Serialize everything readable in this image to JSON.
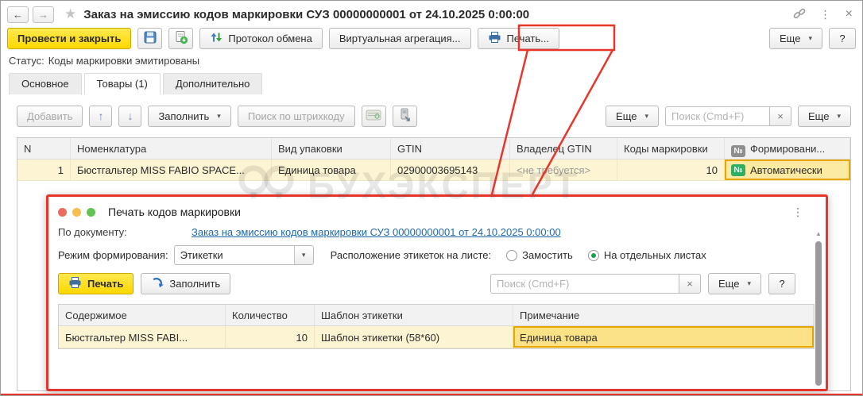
{
  "window": {
    "title": "Заказ на эмиссию кодов маркировки СУЗ 00000000001 от 24.10.2025 0:00:00"
  },
  "icons": {
    "back": "←",
    "forward": "→",
    "star": "★",
    "menu_dots": "⋮",
    "close": "×",
    "caret": "▾",
    "move_up": "↑",
    "move_down": "↓",
    "number_badge": "№",
    "scroll_up": "▲",
    "clear": "×"
  },
  "toolbar": {
    "post_and_close": "Провести и закрыть",
    "exchange_protocol": "Протокол обмена",
    "virtual_aggregation": "Виртуальная агрегация...",
    "print": "Печать...",
    "more": "Еще",
    "help": "?"
  },
  "status": {
    "label": "Статус:",
    "value": "Коды маркировки эмитированы"
  },
  "tabs": [
    {
      "label": "Основное"
    },
    {
      "label": "Товары (1)"
    },
    {
      "label": "Дополнительно"
    }
  ],
  "items_toolbar": {
    "add": "Добавить",
    "fill": "Заполнить",
    "barcode_search": "Поиск по штрихкоду",
    "more": "Еще",
    "search_placeholder": "Поиск (Cmd+F)",
    "more2": "Еще"
  },
  "items_table": {
    "headers": [
      "N",
      "Номенклатура",
      "Вид упаковки",
      "GTIN",
      "Владелец GTIN",
      "Коды маркировки",
      "Формировани..."
    ],
    "row": {
      "n": "1",
      "nomenclature": "Бюстгальтер MISS FABIO SPACE...",
      "packaging": "Единица товара",
      "gtin": "02900003695143",
      "gtin_owner": "<не требуется>",
      "marking_codes": "10",
      "formation": "Автоматически"
    }
  },
  "dialog": {
    "title": "Печать кодов маркировки",
    "by_document_label": "По документу:",
    "document_link": "Заказ на эмиссию кодов маркировки СУЗ 00000000001 от 24.10.2025 0:00:00",
    "mode_label": "Режим формирования:",
    "mode_value": "Этикетки",
    "layout_label": "Расположение этикеток на листе:",
    "layout_options": [
      {
        "label": "Замостить",
        "selected": false
      },
      {
        "label": "На отдельных листах",
        "selected": true
      }
    ],
    "print": "Печать",
    "fill": "Заполнить",
    "search_placeholder": "Поиск (Cmd+F)",
    "more": "Еще",
    "help": "?",
    "table": {
      "headers": [
        "Содержимое",
        "Количество",
        "Шаблон этикетки",
        "Примечание"
      ],
      "row": {
        "content": "Бюстгальтер MISS FABI...",
        "quantity": "10",
        "template": "Шаблон этикетки (58*60)",
        "note": "Единица товара"
      }
    }
  },
  "watermark": {
    "text": "БУХЭКСПЕРТ"
  },
  "colors": {
    "accent_yellow": "#ffdd00",
    "annotation_red": "#e8352c",
    "link_blue": "#2069b0",
    "badge_green": "#2fae63",
    "selection_orange": "#e7a600"
  }
}
